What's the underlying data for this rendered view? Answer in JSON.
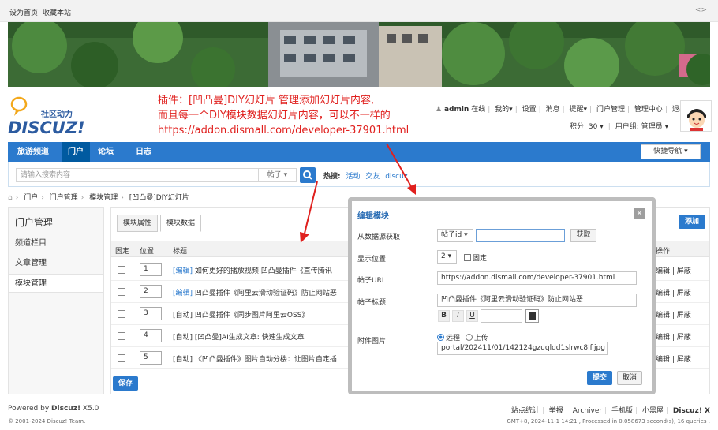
{
  "topbar": {
    "set_home": "设为首页",
    "bookmark": "收藏本站",
    "toggle_icon": "<>"
  },
  "logo": {
    "tag": "社区动力",
    "brand": "DISCUZ!"
  },
  "annotation": {
    "line1": "插件：[凹凸曼]DIY幻灯片 管理添加幻灯片内容,",
    "line2": "而且每一个DIY模块数据幻灯片内容，可以不一样的",
    "line3": "https://addon.dismall.com/developer-37901.html"
  },
  "user": {
    "name": "admin",
    "status": "在线",
    "my": "我的",
    "settings": "设置",
    "messages": "消息",
    "remind": "提醒",
    "portal_admin": "门户管理",
    "admin_center": "管理中心",
    "logout": "退出",
    "credits": "积分: 30",
    "group": "用户组: 管理员"
  },
  "nav": {
    "items": [
      "旅游频道",
      "门户",
      "论坛",
      "日志"
    ],
    "active": 1,
    "quick": "快捷导航"
  },
  "search": {
    "placeholder": "请输入搜索内容",
    "type": "帖子",
    "hot_label": "热搜:",
    "hot": [
      "活动",
      "交友",
      "discuz"
    ]
  },
  "breadcrumb": [
    "门户",
    "门户管理",
    "模块管理",
    "[凹凸曼]DIY幻灯片"
  ],
  "sidebar": {
    "title": "门户管理",
    "items": [
      "频道栏目",
      "文章管理",
      "模块管理"
    ],
    "active": 2
  },
  "tabs": [
    "模块属性",
    "模块数据"
  ],
  "add_button": "添加",
  "table": {
    "headers": [
      "固定",
      "位置",
      "标题",
      "操作"
    ],
    "rows": [
      {
        "pos": "1",
        "tag": "[编辑]",
        "title": "如何更好的播放视频 凹凸曼插件《直传腾讯"
      },
      {
        "pos": "2",
        "tag": "[编辑]",
        "title": "凹凸曼插件《阿里云滑动验证码》防止网站恶"
      },
      {
        "pos": "3",
        "tag": "[自动]",
        "title": "凹凸曼插件《同步图片阿里云OSS》"
      },
      {
        "pos": "4",
        "tag": "[自动]",
        "title": "[凹凸曼]AI生成文章: 快速生成文章"
      },
      {
        "pos": "5",
        "tag": "[自动]",
        "title": "《凹凸曼插件》图片自动分楼：让图片自定插"
      }
    ],
    "op_edit": "编辑",
    "op_block": "屏蔽"
  },
  "save_button": "保存",
  "modal": {
    "title": "编辑模块",
    "close": "×",
    "source_label": "从数据源获取",
    "source_select": "帖子id",
    "fetch_button": "获取",
    "pos_label": "显示位置",
    "pos_value": "2",
    "fixed_label": "固定",
    "url_label": "帖子URL",
    "url_value": "https://addon.dismall.com/developer-37901.html",
    "title_label": "帖子标题",
    "title_value": "凹凸曼插件《阿里云滑动验证码》防止网站恶",
    "fmt_b": "B",
    "fmt_i": "I",
    "fmt_u": "U",
    "img_label": "附件图片",
    "remote": "远程",
    "upload": "上传",
    "img_value": "portal/202411/01/142124gzuqldd1slrwc8lf.jpg",
    "submit": "提交",
    "cancel": "取消"
  },
  "footer": {
    "powered": "Powered by",
    "brand": "Discuz!",
    "version": "X5.0",
    "copyright": "© 2001-2024 Discuz! Team.",
    "links": [
      "站点统计",
      "举报",
      "Archiver",
      "手机版",
      "小黑屋"
    ],
    "brand_right": "Discuz! X",
    "stats": "GMT+8, 2024-11-1 14:21 , Processed in 0.058673 second(s), 16 queries ."
  }
}
